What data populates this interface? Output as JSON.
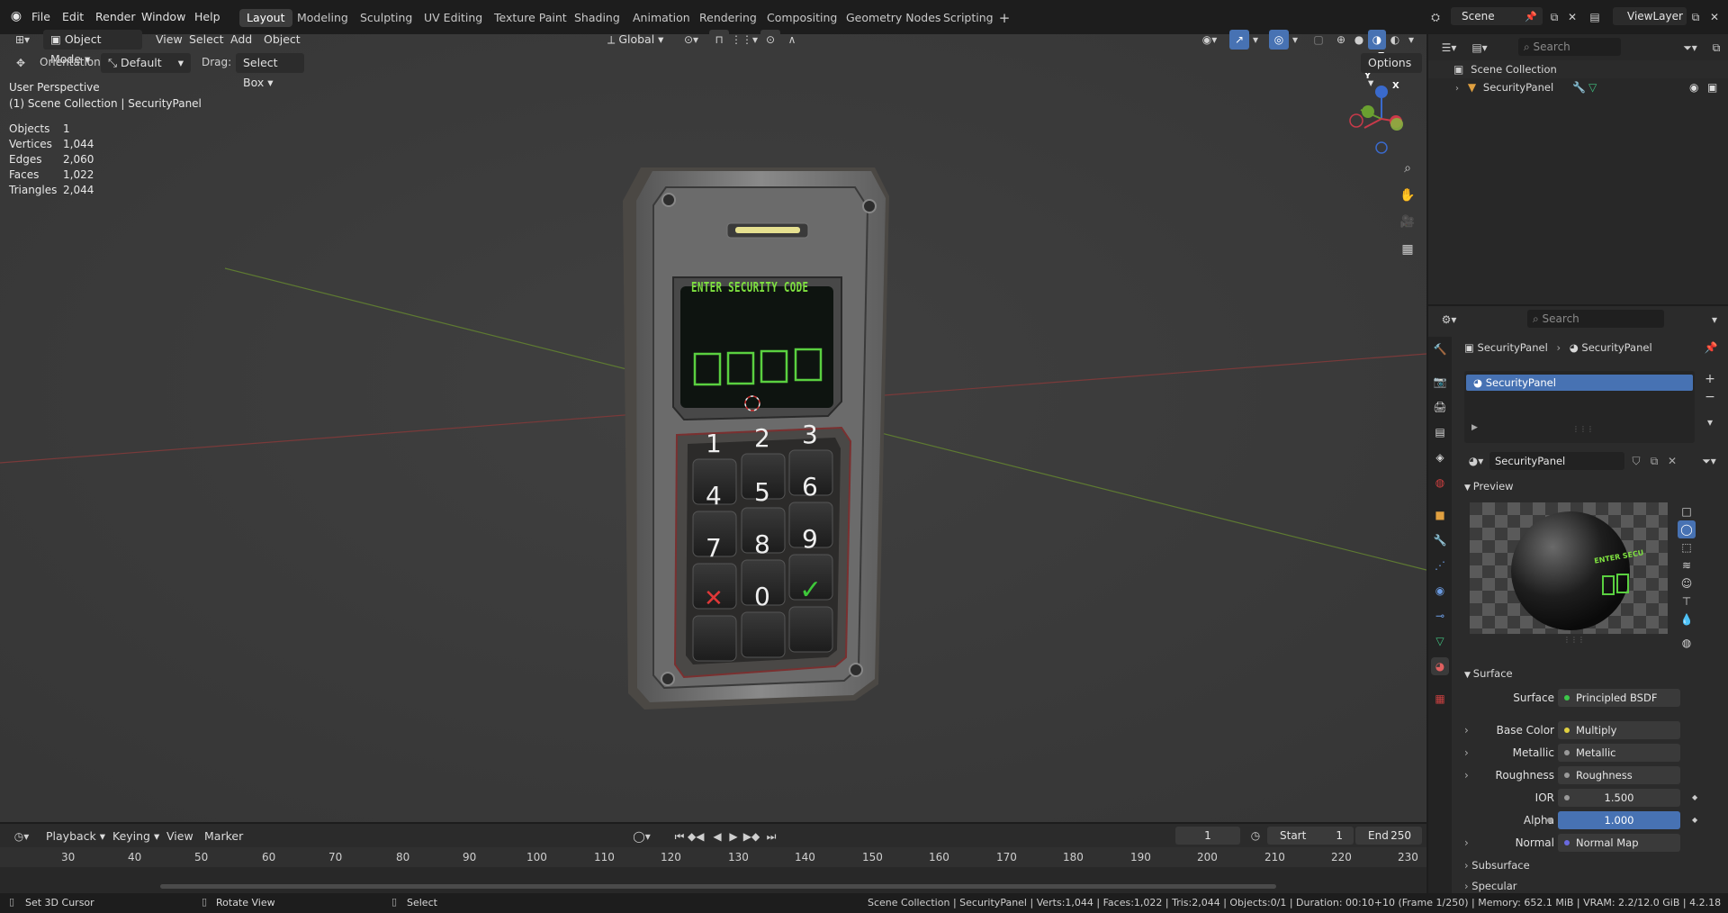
{
  "menu": {
    "file": "File",
    "edit": "Edit",
    "render": "Render",
    "window": "Window",
    "help": "Help"
  },
  "workspaces": [
    "Layout",
    "Modeling",
    "Sculpting",
    "UV Editing",
    "Texture Paint",
    "Shading",
    "Animation",
    "Rendering",
    "Compositing",
    "Geometry Nodes",
    "Scripting"
  ],
  "scene": {
    "name": "Scene",
    "view_layer": "ViewLayer"
  },
  "viewport_header": {
    "mode": "Object Mode",
    "view": "View",
    "select": "Select",
    "add": "Add",
    "object": "Object",
    "transform_space": "Global",
    "orientation_label": "Orientation:",
    "orientation_value": "Default",
    "drag_label": "Drag:",
    "drag_value": "Select Box",
    "options": "Options"
  },
  "overlay": {
    "perspective": "User Perspective",
    "collection": "(1) Scene Collection | SecurityPanel",
    "stats": [
      {
        "label": "Objects",
        "value": "1"
      },
      {
        "label": "Vertices",
        "value": "1,044"
      },
      {
        "label": "Edges",
        "value": "2,060"
      },
      {
        "label": "Faces",
        "value": "1,022"
      },
      {
        "label": "Triangles",
        "value": "2,044"
      }
    ]
  },
  "model": {
    "screen_text": "ENTER SECURITY CODE",
    "keys": [
      "1",
      "2",
      "3",
      "4",
      "5",
      "6",
      "7",
      "8",
      "9",
      "✕",
      "0",
      "✓"
    ]
  },
  "gizmo": {
    "x": "X",
    "y": "Y",
    "z": "Z"
  },
  "outliner": {
    "search_placeholder": "Search",
    "root": "Scene Collection",
    "object": "SecurityPanel"
  },
  "properties": {
    "search_placeholder": "Search",
    "breadcrumb_object": "SecurityPanel",
    "breadcrumb_material": "SecurityPanel",
    "slot": "SecurityPanel",
    "material_name": "SecurityPanel",
    "preview_label": "Preview",
    "preview_text": "ENTER SECU",
    "surface_section": "Surface",
    "rows": [
      {
        "label": "Surface",
        "value": "Principled BSDF",
        "dot": "#3cc84a",
        "expand": false
      },
      {
        "label": "Base Color",
        "value": "Multiply",
        "dot": "#e0d040",
        "expand": true
      },
      {
        "label": "Metallic",
        "value": "Metallic",
        "dot": "#9a9a9a",
        "expand": true
      },
      {
        "label": "Roughness",
        "value": "Roughness",
        "dot": "#9a9a9a",
        "expand": true
      },
      {
        "label": "IOR",
        "value": "1.500",
        "dot": "#9a9a9a",
        "expand": false
      },
      {
        "label": "Alpha",
        "value": "1.000",
        "dot": "#9a9a9a",
        "expand": false
      },
      {
        "label": "Normal",
        "value": "Normal Map",
        "dot": "#6a6ae0",
        "expand": true
      }
    ],
    "subsurface": "Subsurface",
    "specular": "Specular"
  },
  "timeline": {
    "playback": "Playback",
    "keying": "Keying",
    "view": "View",
    "marker": "Marker",
    "current_frame": "1",
    "start_label": "Start",
    "start": "1",
    "end_label": "End",
    "end": "250",
    "ticks": [
      "30",
      "40",
      "50",
      "60",
      "70",
      "80",
      "90",
      "100",
      "110",
      "120",
      "130",
      "140",
      "150",
      "160",
      "170",
      "180",
      "190",
      "200",
      "210",
      "220",
      "230"
    ]
  },
  "status": {
    "left1": "Set 3D Cursor",
    "left2": "Rotate View",
    "left3": "Select",
    "info": "Scene Collection | SecurityPanel | Verts:1,044 | Faces:1,022 | Tris:2,044 | Objects:0/1 | Duration: 00:10+10 (Frame 1/250) | Memory: 652.1 MiB | VRAM: 2.2/12.0 GiB | 4.2.18"
  },
  "colors": {
    "accent": "#4772b3",
    "active_field": "#4772b3",
    "screen_green": "#7ee040"
  }
}
